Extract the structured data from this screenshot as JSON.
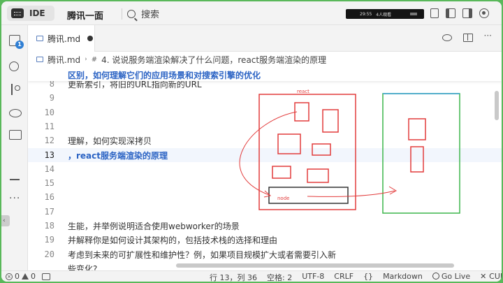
{
  "topbar": {
    "ide_label": "IDE",
    "title": "腾讯一面",
    "search_label": "搜索",
    "status_time": "29:55",
    "status_viewers": "4人观看"
  },
  "activity": {
    "badge": "1",
    "more": "···"
  },
  "tab": {
    "label": "腾讯.md"
  },
  "breadcrumb": {
    "file": "腾讯.md",
    "hash": "#",
    "section": "4. 说说服务端渲染解决了什么问题，react服务端渲染的原理"
  },
  "editor": {
    "sticky": "区别，如何理解它们的应用场景和对搜索引擎的优化",
    "lines": [
      {
        "num": "8",
        "text": "更新索引，将旧的URL指向新的URL",
        "style": "normal"
      },
      {
        "num": "9",
        "text": "",
        "style": "normal"
      },
      {
        "num": "10",
        "text": "",
        "style": "normal"
      },
      {
        "num": "11",
        "text": "",
        "style": "normal"
      },
      {
        "num": "12",
        "text": "理解，如何实现深拷贝",
        "style": "normal"
      },
      {
        "num": "13",
        "text": "，react服务端渲染的原理",
        "style": "strong"
      },
      {
        "num": "14",
        "text": "",
        "style": "normal"
      },
      {
        "num": "15",
        "text": "",
        "style": "normal"
      },
      {
        "num": "16",
        "text": "",
        "style": "normal"
      },
      {
        "num": "17",
        "text": "",
        "style": "normal"
      },
      {
        "num": "18",
        "text": "生能，并举例说明适合使用webworker的场景",
        "style": "normal"
      },
      {
        "num": "19",
        "text": "并解释你是如何设计其架构的，包括技术栈的选择和理由",
        "style": "normal"
      },
      {
        "num": "20",
        "text": "考虑到未来的可扩展性和维护性？例，如果项目规模扩大或者需要引入新",
        "style": "normal"
      },
      {
        "num": "",
        "text": "些变化?",
        "style": "normal"
      }
    ]
  },
  "drawing": {
    "label_react": "react",
    "label_node": "node",
    "color_red": "#e23b3b",
    "color_green": "#3cb54a",
    "color_dark": "#333333"
  },
  "statusbar": {
    "errors": "0",
    "warnings": "0",
    "position": "行 13，列 36",
    "spaces": "空格: 2",
    "encoding": "UTF-8",
    "eol": "CRLF",
    "braces": "{}",
    "language": "Markdown",
    "golive": "Go Live",
    "cue": "CUE"
  }
}
